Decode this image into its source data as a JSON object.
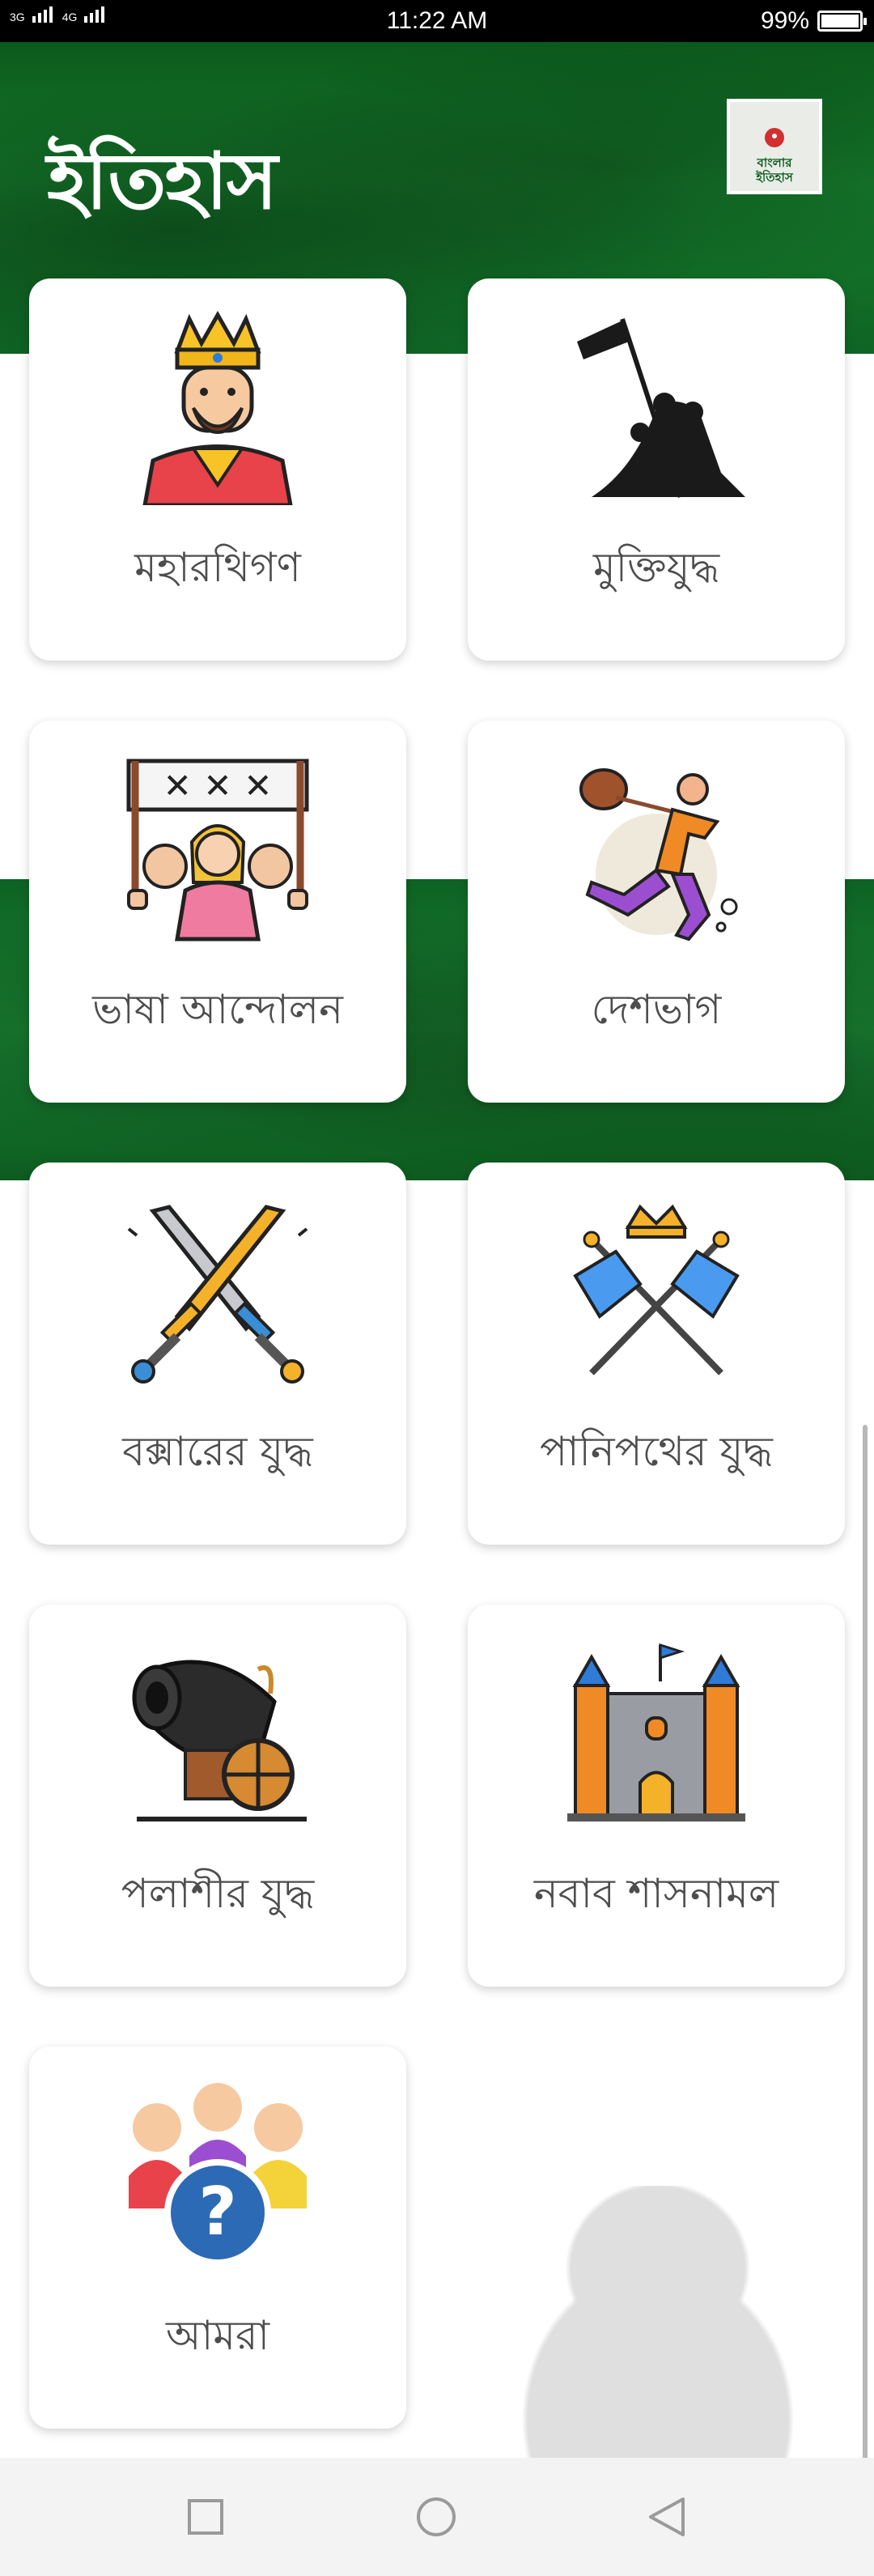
{
  "status_bar": {
    "network_1": "3G",
    "network_2": "4G",
    "time": "11:22 AM",
    "battery": "99%",
    "battery_level": 0.99
  },
  "header": {
    "title": "ইতিহাস",
    "logo_text_1": "বাংলার",
    "logo_text_2": "ইতিহাস"
  },
  "categories": [
    {
      "label": "মহারথিগণ",
      "icon": "king-icon"
    },
    {
      "label": "মুক্তিযুদ্ধ",
      "icon": "flag-raising-icon"
    },
    {
      "label": "ভাষা আন্দোলন",
      "icon": "protest-icon"
    },
    {
      "label": "দেশভাগ",
      "icon": "running-man-icon"
    },
    {
      "label": "বক্সারের যুদ্ধ",
      "icon": "crossed-swords-icon"
    },
    {
      "label": "পানিপথের যুদ্ধ",
      "icon": "crossed-flags-icon"
    },
    {
      "label": "পলাশীর যুদ্ধ",
      "icon": "cannon-icon"
    },
    {
      "label": "নবাব শাসনামল",
      "icon": "castle-icon"
    },
    {
      "label": "আমরা",
      "icon": "people-question-icon"
    }
  ],
  "colors": {
    "header_green": "#157a2b",
    "card_label": "#4d4d4d",
    "info_blue": "#2d6ab5"
  }
}
